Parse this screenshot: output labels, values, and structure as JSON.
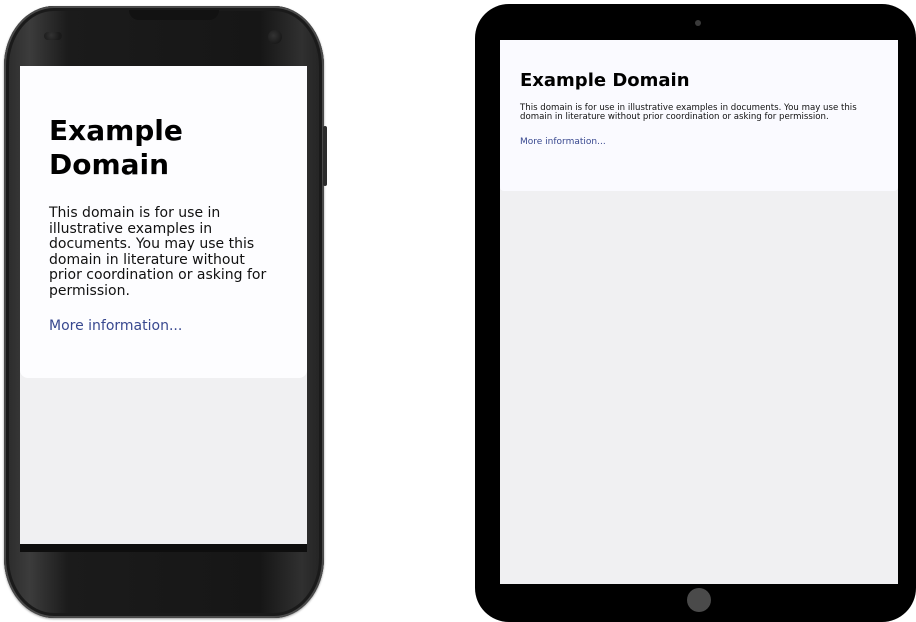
{
  "phone": {
    "page": {
      "heading": "Example Domain",
      "body": "This domain is for use in illustrative examples in documents. You may use this domain in literature without prior coordination or asking for permission.",
      "link": "More information..."
    }
  },
  "tablet": {
    "page": {
      "heading": "Example Domain",
      "body": "This domain is for use in illustrative examples in documents. You may use this domain in literature without prior coordination or asking for permission.",
      "link": "More information..."
    }
  },
  "colors": {
    "link": "#38488f",
    "card_background": "#fdfdff",
    "page_background": "#f0f0f2",
    "device_frame": "#000000"
  }
}
